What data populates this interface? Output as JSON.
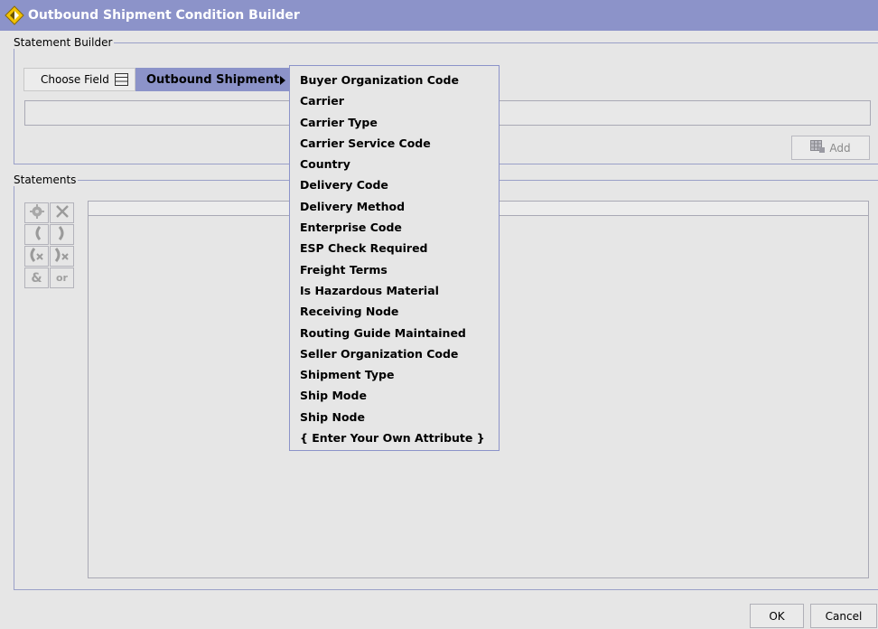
{
  "window": {
    "title": "Outbound Shipment Condition Builder"
  },
  "statement_builder": {
    "label": "Statement Builder",
    "choose_field_label": "Choose Field",
    "selected_category": "Outbound Shipment",
    "field_value": "",
    "add_label": "Add"
  },
  "statements": {
    "label": "Statements",
    "toolbar": [
      "gear-icon",
      "delete-icon",
      "open-paren-icon",
      "close-paren-icon",
      "remove-open-paren-icon",
      "remove-close-paren-icon",
      "and-icon",
      "or"
    ],
    "or_label": "or",
    "and_glyph": "&"
  },
  "menu": {
    "items": [
      "Buyer Organization Code",
      "Carrier",
      "Carrier Type",
      "Carrier Service Code",
      "Country",
      "Delivery Code",
      "Delivery Method",
      "Enterprise Code",
      "ESP Check Required",
      "Freight Terms",
      "Is Hazardous Material",
      "Receiving Node",
      "Routing Guide Maintained",
      "Seller Organization Code",
      "Shipment Type",
      "Ship Mode",
      "Ship Node",
      "{ Enter Your Own Attribute }"
    ]
  },
  "footer": {
    "ok_label": "OK",
    "cancel_label": "Cancel"
  },
  "colors": {
    "titlebar": "#8c93c9",
    "highlight": "#8c93c9",
    "background": "#e6e6e6"
  }
}
